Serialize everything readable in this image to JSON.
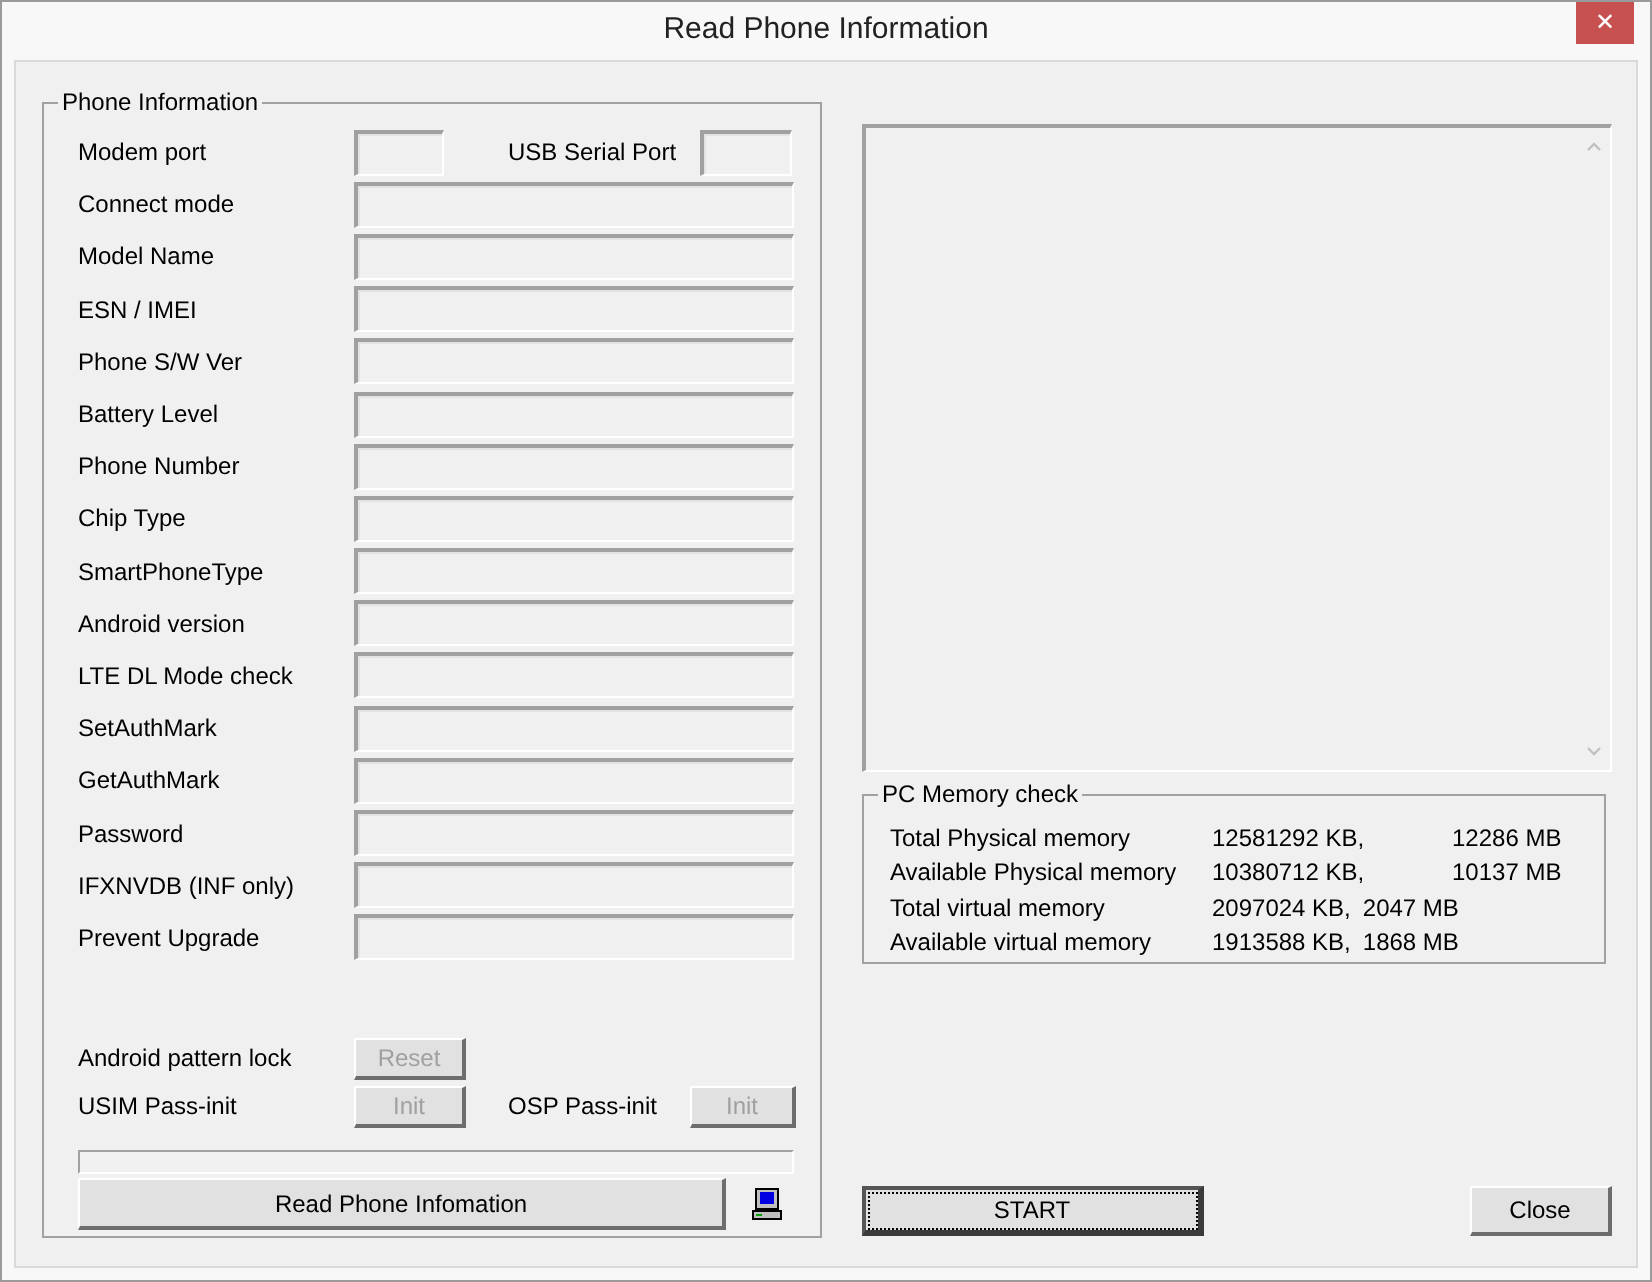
{
  "window": {
    "title": "Read Phone Information",
    "close_glyph": "✕"
  },
  "phone_information": {
    "title": "Phone Information",
    "port_row": {
      "modem_label": "Modem port",
      "usb_label": "USB Serial Port"
    },
    "fields": [
      {
        "label": "Connect mode"
      },
      {
        "label": "Model Name"
      },
      {
        "label": "ESN / IMEI"
      },
      {
        "label": "Phone S/W Ver"
      },
      {
        "label": "Battery Level"
      },
      {
        "label": "Phone Number"
      },
      {
        "label": "Chip Type"
      },
      {
        "label": "SmartPhoneType"
      },
      {
        "label": "Android version"
      },
      {
        "label": "LTE DL Mode check"
      },
      {
        "label": "SetAuthMark"
      },
      {
        "label": "GetAuthMark"
      },
      {
        "label": "Password"
      },
      {
        "label": "IFXNVDB (INF only)"
      },
      {
        "label": "Prevent Upgrade"
      }
    ],
    "pattern_lock": {
      "label": "Android pattern lock",
      "button": {
        "label": "Reset",
        "disabled": true
      }
    },
    "pass_init": {
      "usim_label": "USIM Pass-init",
      "usim_button": {
        "label": "Init",
        "disabled": true
      },
      "osp_label": "OSP Pass-init",
      "osp_button": {
        "label": "Init",
        "disabled": true
      }
    },
    "progress": {
      "level": 0
    },
    "read_button": {
      "label": "Read Phone Infomation"
    }
  },
  "pc_memory": {
    "title": "PC Memory check",
    "rows": [
      {
        "label": "Total Physical memory",
        "kb": "12581292 KB,",
        "mb": "12286 MB",
        "kind": "tabbed"
      },
      {
        "label": "Available Physical memory",
        "kb": "10380712 KB,",
        "mb": "10137 MB",
        "kind": "tabbed"
      },
      {
        "label": "Total virtual memory",
        "kb": "2097024 KB,",
        "mb": "2047 MB",
        "kind": "inline"
      },
      {
        "label": "Available virtual memory",
        "kb": "1913588 KB,",
        "mb": "1868 MB",
        "kind": "inline"
      }
    ]
  },
  "start_button": {
    "label": "START",
    "focused": true
  },
  "close_button": {
    "label": "Close",
    "focused": false
  }
}
